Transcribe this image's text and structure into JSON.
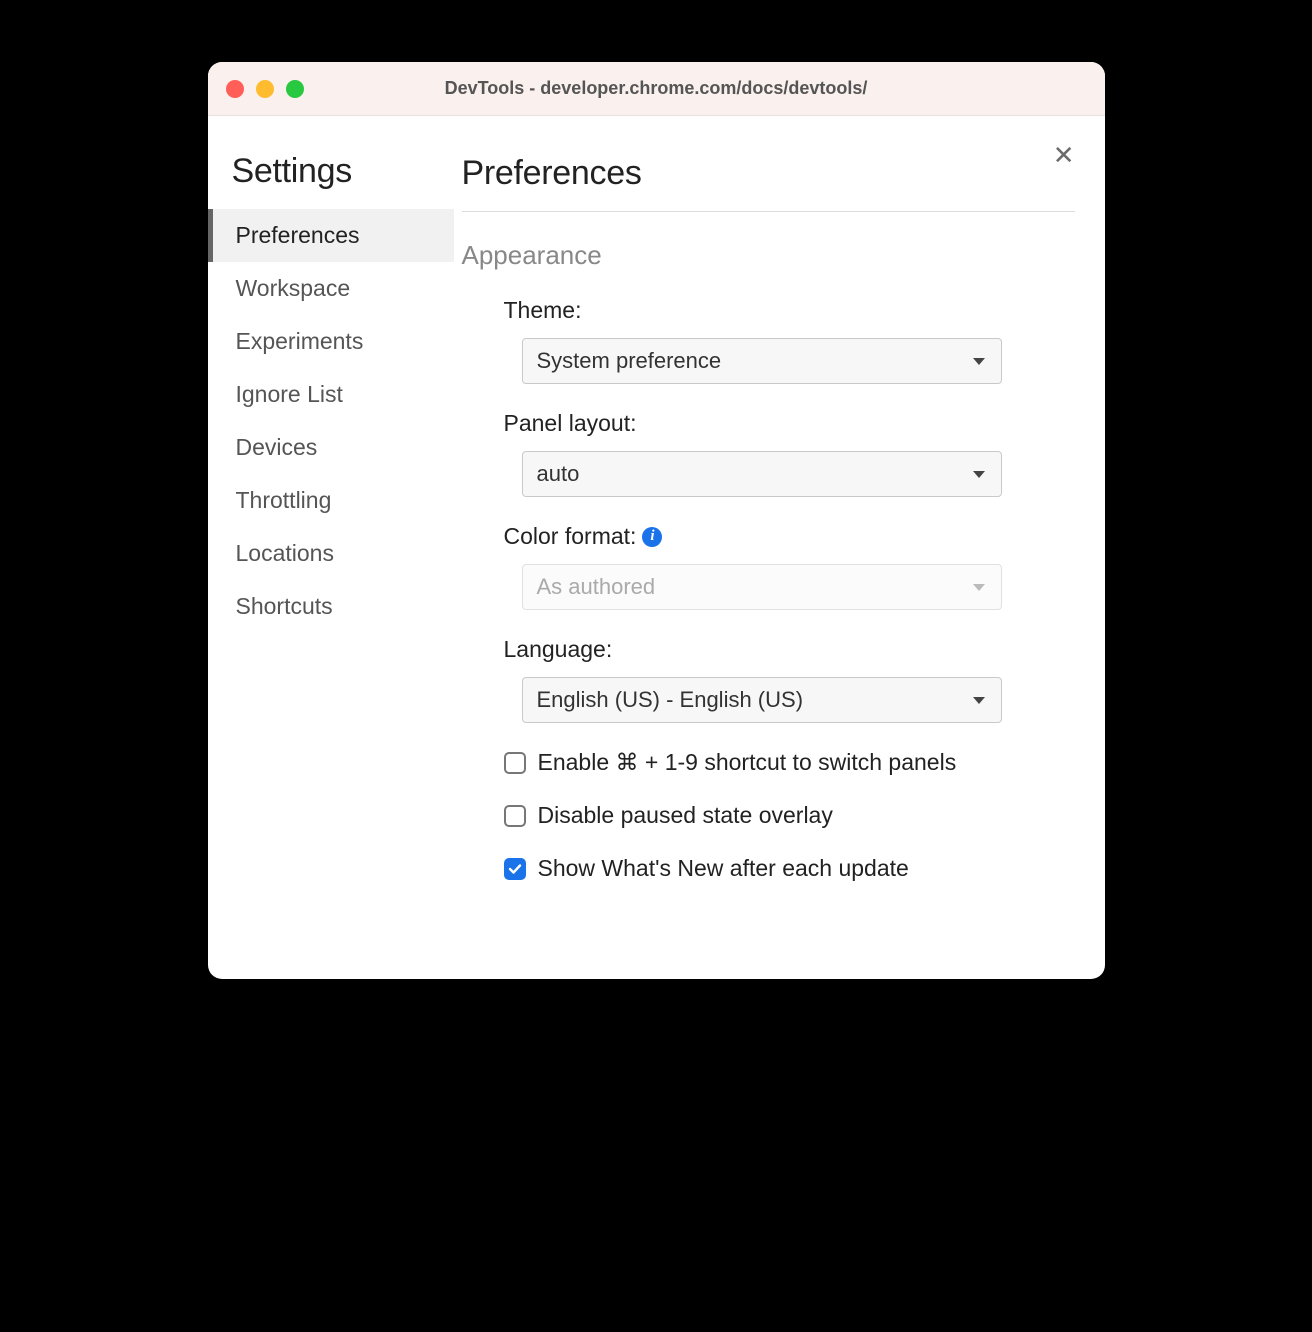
{
  "window": {
    "title": "DevTools - developer.chrome.com/docs/devtools/"
  },
  "sidebar": {
    "title": "Settings",
    "items": [
      {
        "label": "Preferences",
        "active": true
      },
      {
        "label": "Workspace",
        "active": false
      },
      {
        "label": "Experiments",
        "active": false
      },
      {
        "label": "Ignore List",
        "active": false
      },
      {
        "label": "Devices",
        "active": false
      },
      {
        "label": "Throttling",
        "active": false
      },
      {
        "label": "Locations",
        "active": false
      },
      {
        "label": "Shortcuts",
        "active": false
      }
    ]
  },
  "main": {
    "title": "Preferences",
    "section": "Appearance",
    "fields": {
      "theme": {
        "label": "Theme:",
        "value": "System preference",
        "disabled": false
      },
      "panel_layout": {
        "label": "Panel layout:",
        "value": "auto",
        "disabled": false
      },
      "color_format": {
        "label": "Color format:",
        "value": "As authored",
        "disabled": true,
        "info": true
      },
      "language": {
        "label": "Language:",
        "value": "English (US) - English (US)",
        "disabled": false
      }
    },
    "checks": [
      {
        "label": "Enable ⌘ + 1-9 shortcut to switch panels",
        "checked": false
      },
      {
        "label": "Disable paused state overlay",
        "checked": false
      },
      {
        "label": "Show What's New after each update",
        "checked": true
      }
    ]
  }
}
